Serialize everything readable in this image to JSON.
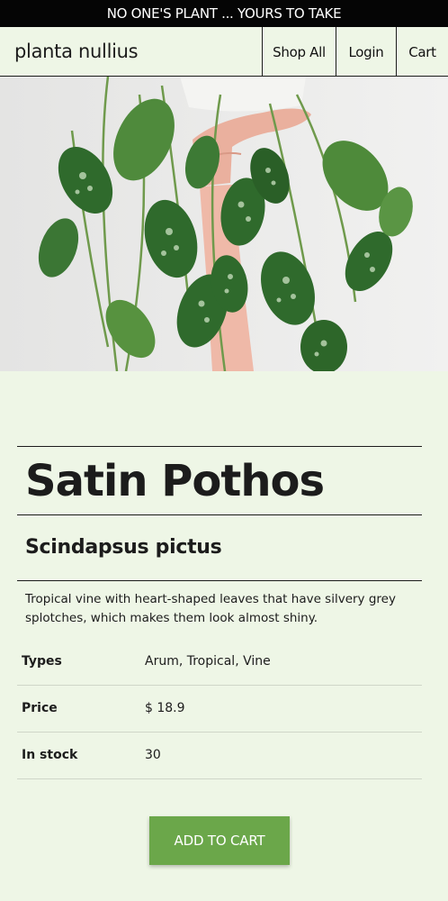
{
  "banner": {
    "text": "NO ONE'S PLANT ... YOURS TO TAKE"
  },
  "nav": {
    "brand": "planta nullius",
    "links": [
      "Shop All",
      "Login",
      "Cart"
    ]
  },
  "product": {
    "name": "Satin Pothos",
    "scientific_name": "Scindapsus pictus",
    "description": "Tropical vine with heart-shaped leaves that have silvery grey splotches, which makes them look almost shiny.",
    "specs": [
      {
        "label": "Types",
        "value": "Arum, Tropical, Vine"
      },
      {
        "label": "Price",
        "value": "$ 18.9"
      },
      {
        "label": "In stock",
        "value": "30"
      }
    ],
    "add_to_cart_label": "ADD TO CART"
  },
  "colors": {
    "background": "#eef6e6",
    "banner": "#050505",
    "button": "#6ba74a"
  }
}
